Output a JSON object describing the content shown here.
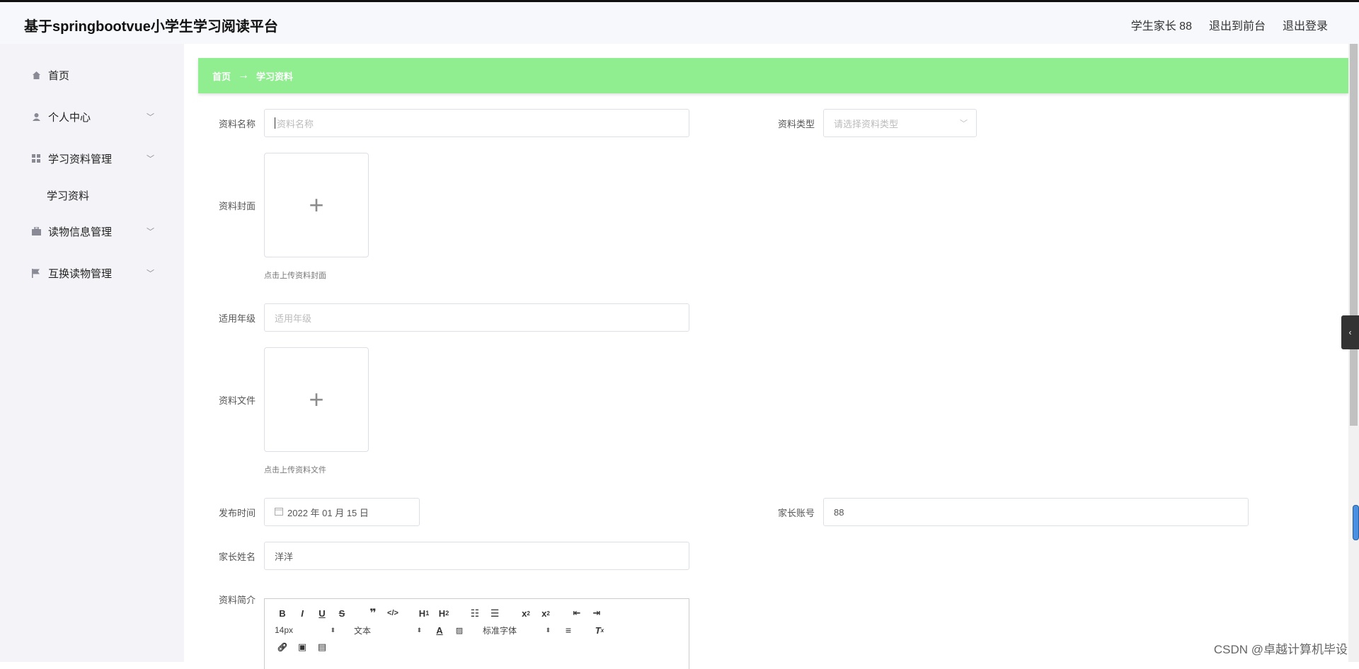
{
  "header": {
    "title": "基于springbootvue小学生学习阅读平台",
    "user_label": "学生家长 88",
    "front_label": "退出到前台",
    "logout_label": "退出登录"
  },
  "sidebar": {
    "items": [
      {
        "label": "首页",
        "icon": "home-icon",
        "has_arrow": false
      },
      {
        "label": "个人中心",
        "icon": "user-icon",
        "has_arrow": true
      },
      {
        "label": "学习资料管理",
        "icon": "grid-icon",
        "has_arrow": true
      },
      {
        "label": "学习资料",
        "icon": "",
        "has_arrow": false,
        "sub": true
      },
      {
        "label": "读物信息管理",
        "icon": "briefcase-icon",
        "has_arrow": true
      },
      {
        "label": "互换读物管理",
        "icon": "flag-icon",
        "has_arrow": true
      }
    ]
  },
  "breadcrumb": {
    "home": "首页",
    "sep": "→",
    "current": "学习资料"
  },
  "form": {
    "name_label": "资料名称",
    "name_placeholder": "资料名称",
    "type_label": "资料类型",
    "type_placeholder": "请选择资料类型",
    "cover_label": "资料封面",
    "cover_hint": "点击上传资料封面",
    "grade_label": "适用年级",
    "grade_placeholder": "适用年级",
    "file_label": "资料文件",
    "file_hint": "点击上传资料文件",
    "publish_label": "发布时间",
    "publish_value": "2022 年 01 月 15 日",
    "account_label": "家长账号",
    "account_value": "88",
    "parent_name_label": "家长姓名",
    "parent_name_value": "洋洋",
    "intro_label": "资料简介"
  },
  "editor": {
    "font_size": "14px",
    "block_type": "文本",
    "font_family": "标准字体"
  },
  "watermark": "CSDN @卓越计算机毕设",
  "colors": {
    "breadcrumb_bg": "#90ee90",
    "sidebar_bg": "#f4f4f8"
  }
}
